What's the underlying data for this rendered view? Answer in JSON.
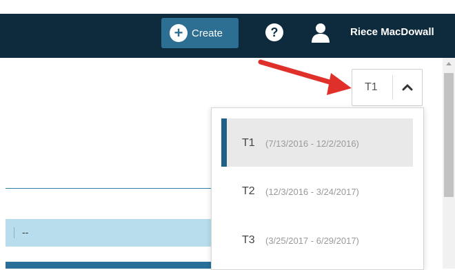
{
  "header": {
    "create_label": "Create",
    "user_name": "Riece MacDowall"
  },
  "term_select": {
    "selected": "T1"
  },
  "dropdown": {
    "items": [
      {
        "term": "T1",
        "range": "(7/13/2016 - 12/2/2016)"
      },
      {
        "term": "T2",
        "range": "(12/3/2016 - 3/24/2017)"
      },
      {
        "term": "T3",
        "range": "(3/25/2017 - 6/29/2017)"
      }
    ]
  },
  "table": {
    "row_value": "--"
  },
  "colors": {
    "topbar": "#0e2b3d",
    "create_button": "#2d6f93",
    "selected_accent": "#1d5f86",
    "annotation_arrow": "#e0302a"
  }
}
